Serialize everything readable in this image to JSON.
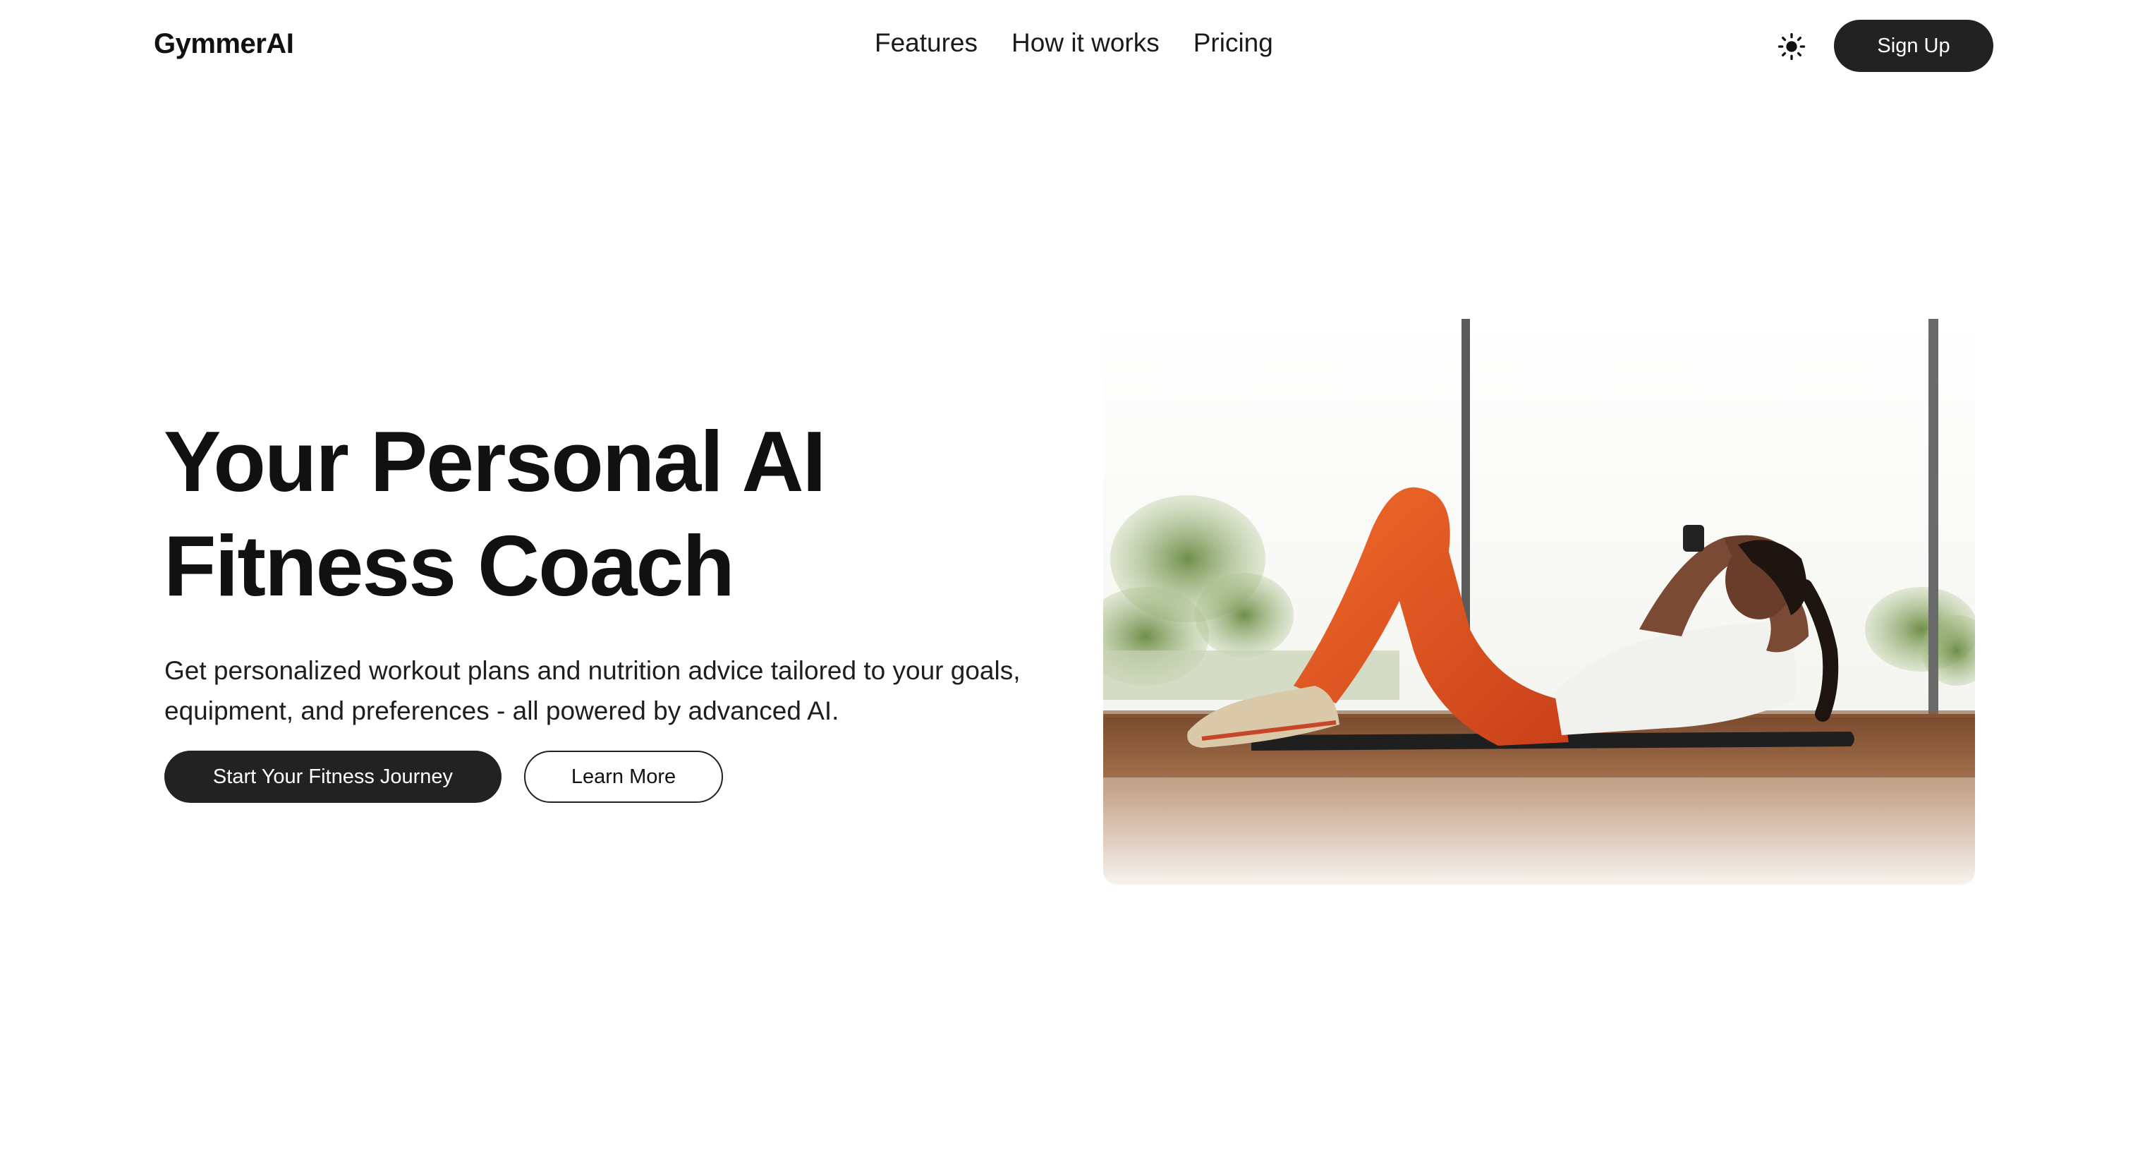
{
  "nav": {
    "logo": "GymmerAI",
    "links": [
      "Features",
      "How it works",
      "Pricing"
    ],
    "theme_icon": "sun-icon",
    "signup_label": "Sign Up"
  },
  "hero": {
    "title_line1": "Your Personal AI",
    "title_line2": "Fitness Coach",
    "subtitle_line1": "Get personalized workout plans and nutrition advice tailored to your goals,",
    "subtitle_line2": "equipment, and preferences - all powered by advanced AI.",
    "primary_cta": "Start Your Fitness Journey",
    "secondary_cta": "Learn More",
    "image_alt": "Woman doing crunches on a yoga mat"
  },
  "colors": {
    "background": "#ffffff",
    "primary_button": "#222222",
    "text": "#141414",
    "accent_leggings": "#e8561f"
  }
}
